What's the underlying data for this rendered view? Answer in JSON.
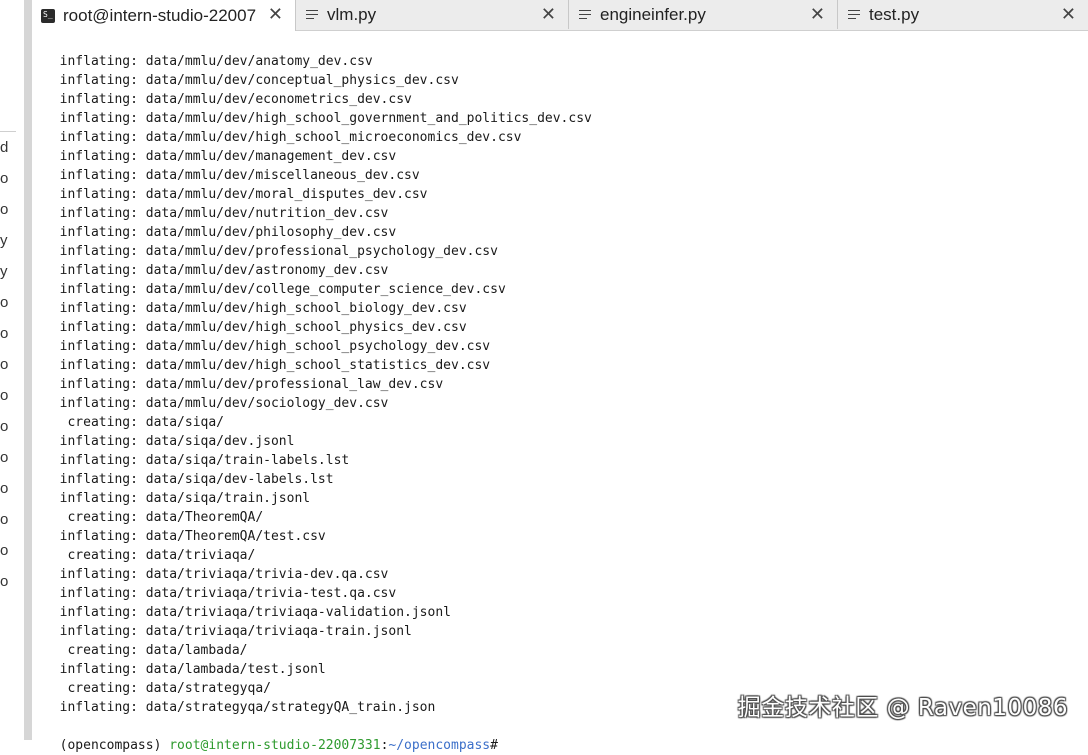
{
  "left_panel": {
    "items": [
      "d",
      "o",
      "o",
      "y",
      "y",
      "o",
      "o",
      "o",
      "o",
      "o",
      "o",
      "o",
      "o",
      "o",
      "o"
    ]
  },
  "tabs": [
    {
      "label": "root@intern-studio-22007",
      "icon": "terminal-icon",
      "active": true
    },
    {
      "label": "vlm.py",
      "icon": "document-icon",
      "active": false
    },
    {
      "label": "engineinfer.py",
      "icon": "document-icon",
      "active": false
    },
    {
      "label": "test.py",
      "icon": "document-icon",
      "active": false
    }
  ],
  "close_symbol": "✕",
  "terminal_lines": [
    "  inflating: data/mmlu/dev/anatomy_dev.csv",
    "  inflating: data/mmlu/dev/conceptual_physics_dev.csv",
    "  inflating: data/mmlu/dev/econometrics_dev.csv",
    "  inflating: data/mmlu/dev/high_school_government_and_politics_dev.csv",
    "  inflating: data/mmlu/dev/high_school_microeconomics_dev.csv",
    "  inflating: data/mmlu/dev/management_dev.csv",
    "  inflating: data/mmlu/dev/miscellaneous_dev.csv",
    "  inflating: data/mmlu/dev/moral_disputes_dev.csv",
    "  inflating: data/mmlu/dev/nutrition_dev.csv",
    "  inflating: data/mmlu/dev/philosophy_dev.csv",
    "  inflating: data/mmlu/dev/professional_psychology_dev.csv",
    "  inflating: data/mmlu/dev/astronomy_dev.csv",
    "  inflating: data/mmlu/dev/college_computer_science_dev.csv",
    "  inflating: data/mmlu/dev/high_school_biology_dev.csv",
    "  inflating: data/mmlu/dev/high_school_physics_dev.csv",
    "  inflating: data/mmlu/dev/high_school_psychology_dev.csv",
    "  inflating: data/mmlu/dev/high_school_statistics_dev.csv",
    "  inflating: data/mmlu/dev/professional_law_dev.csv",
    "  inflating: data/mmlu/dev/sociology_dev.csv",
    "   creating: data/siqa/",
    "  inflating: data/siqa/dev.jsonl",
    "  inflating: data/siqa/train-labels.lst",
    "  inflating: data/siqa/dev-labels.lst",
    "  inflating: data/siqa/train.jsonl",
    "   creating: data/TheoremQA/",
    "  inflating: data/TheoremQA/test.csv",
    "   creating: data/triviaqa/",
    "  inflating: data/triviaqa/trivia-dev.qa.csv",
    "  inflating: data/triviaqa/trivia-test.qa.csv",
    "  inflating: data/triviaqa/triviaqa-validation.jsonl",
    "  inflating: data/triviaqa/triviaqa-train.jsonl",
    "   creating: data/lambada/",
    "  inflating: data/lambada/test.jsonl",
    "   creating: data/strategyqa/",
    "  inflating: data/strategyqa/strategyQA_train.json"
  ],
  "prompt": {
    "env": "(opencompass) ",
    "user_host": "root@intern-studio-22007331",
    "colon": ":",
    "path": "~/opencompass",
    "symbol": "#"
  },
  "watermark": "掘金技术社区 @ Raven10086",
  "colors": {
    "prompt_user": "#2e9a2e",
    "prompt_path": "#3b6fc9",
    "tab_bar": "#ececec"
  }
}
